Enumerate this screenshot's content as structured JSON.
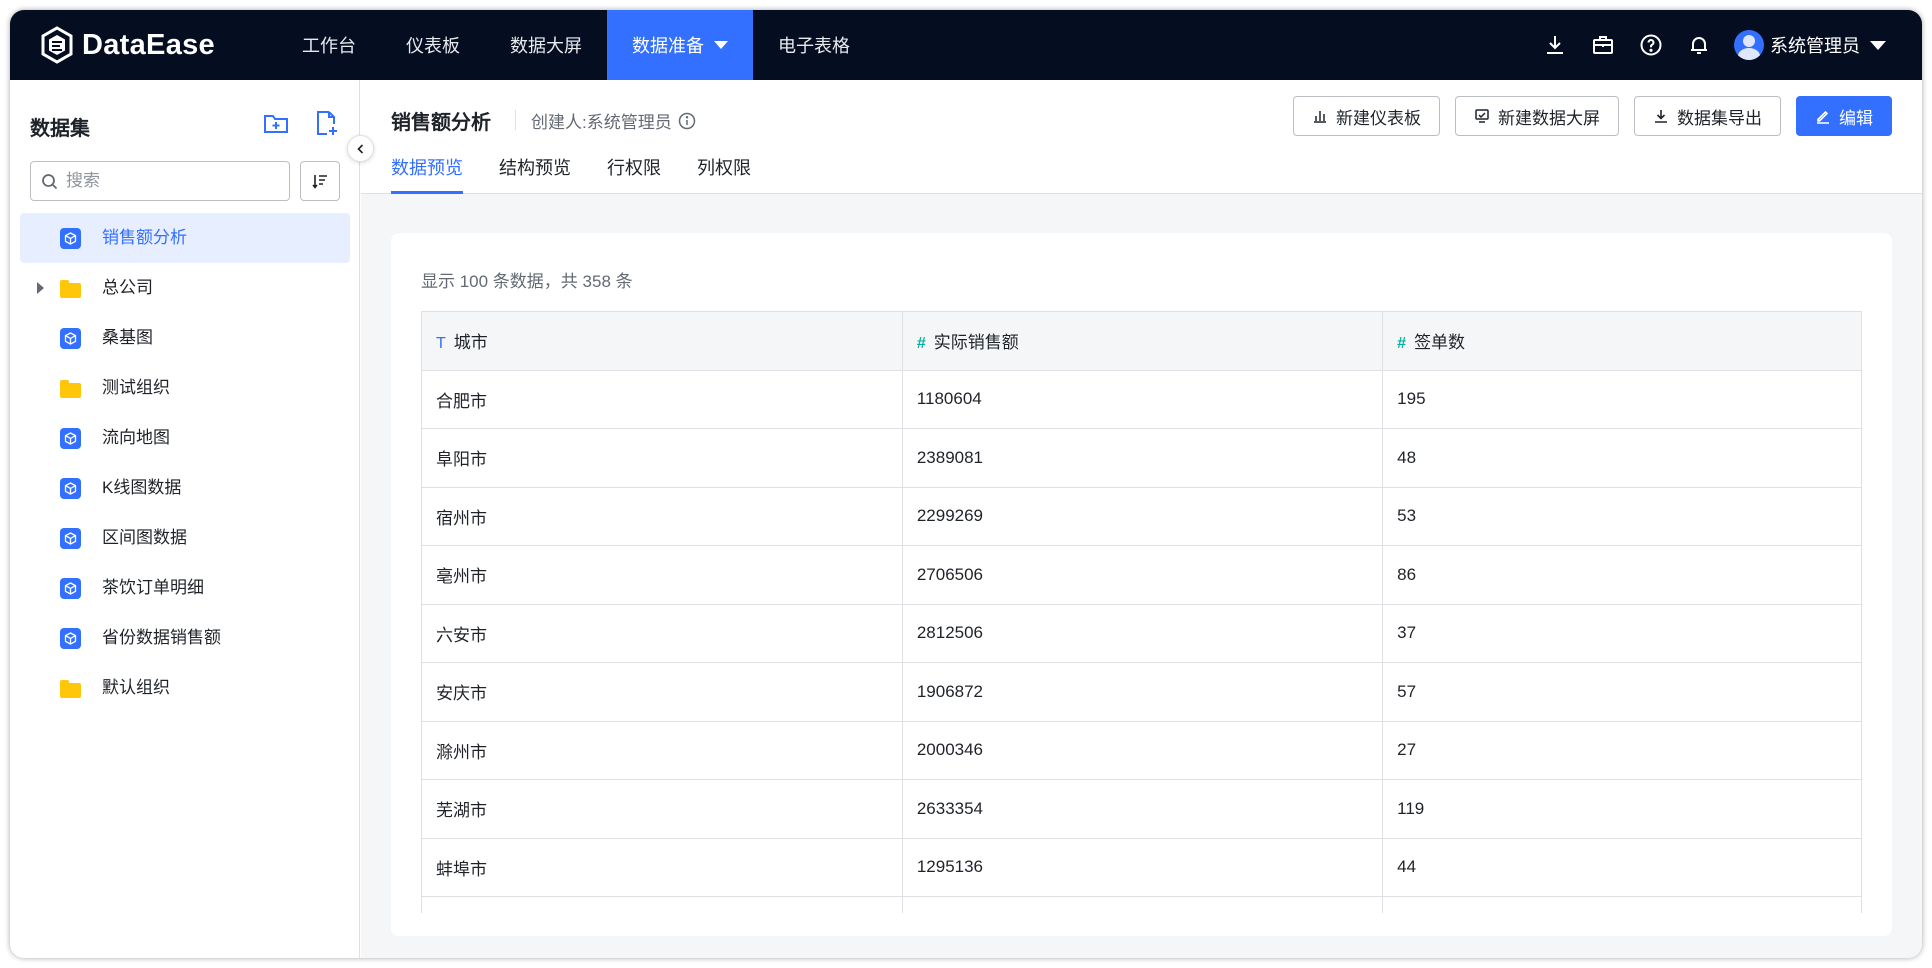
{
  "app": {
    "logo_text": "DataEase"
  },
  "nav": [
    {
      "label": "工作台",
      "active": false
    },
    {
      "label": "仪表板",
      "active": false
    },
    {
      "label": "数据大屏",
      "active": false
    },
    {
      "label": "数据准备",
      "active": true
    },
    {
      "label": "电子表格",
      "active": false
    }
  ],
  "top_icons": [
    "download-icon",
    "briefcase-icon",
    "help-icon",
    "bell-icon"
  ],
  "user": {
    "name": "系统管理员"
  },
  "sidebar": {
    "title": "数据集",
    "search_placeholder": "搜索",
    "items": [
      {
        "label": "销售额分析",
        "type": "dataset",
        "active": true
      },
      {
        "label": "总公司",
        "type": "folder",
        "expandable": true
      },
      {
        "label": "桑基图",
        "type": "dataset"
      },
      {
        "label": "测试组织",
        "type": "folder"
      },
      {
        "label": "流向地图",
        "type": "dataset"
      },
      {
        "label": "K线图数据",
        "type": "dataset"
      },
      {
        "label": "区间图数据",
        "type": "dataset"
      },
      {
        "label": "茶饮订单明细",
        "type": "dataset"
      },
      {
        "label": "省份数据销售额",
        "type": "dataset"
      },
      {
        "label": "默认组织",
        "type": "folder"
      }
    ]
  },
  "header": {
    "title": "销售额分析",
    "creator": "创建人:系统管理员",
    "tabs": [
      {
        "label": "数据预览",
        "active": true
      },
      {
        "label": "结构预览",
        "active": false
      },
      {
        "label": "行权限",
        "active": false
      },
      {
        "label": "列权限",
        "active": false
      }
    ],
    "buttons": {
      "new_dashboard": "新建仪表板",
      "new_screen": "新建数据大屏",
      "export": "数据集导出",
      "edit": "编辑"
    }
  },
  "preview": {
    "summary": "显示 100 条数据，共 358 条",
    "columns": [
      {
        "type_icon": "T",
        "name": "城市"
      },
      {
        "type_icon": "#",
        "name": "实际销售额"
      },
      {
        "type_icon": "#",
        "name": "签单数"
      }
    ],
    "rows": [
      [
        "合肥市",
        "1180604",
        "195"
      ],
      [
        "阜阳市",
        "2389081",
        "48"
      ],
      [
        "宿州市",
        "2299269",
        "53"
      ],
      [
        "亳州市",
        "2706506",
        "86"
      ],
      [
        "六安市",
        "2812506",
        "37"
      ],
      [
        "安庆市",
        "1906872",
        "57"
      ],
      [
        "滁州市",
        "2000346",
        "27"
      ],
      [
        "芜湖市",
        "2633354",
        "119"
      ],
      [
        "蚌埠市",
        "1295136",
        "44"
      ],
      [
        "",
        "",
        ""
      ]
    ]
  },
  "colors": {
    "accent": "#3370ff",
    "nav_bg": "#050e21",
    "folder": "#ffc60a",
    "numeric_type": "#04b49c"
  }
}
